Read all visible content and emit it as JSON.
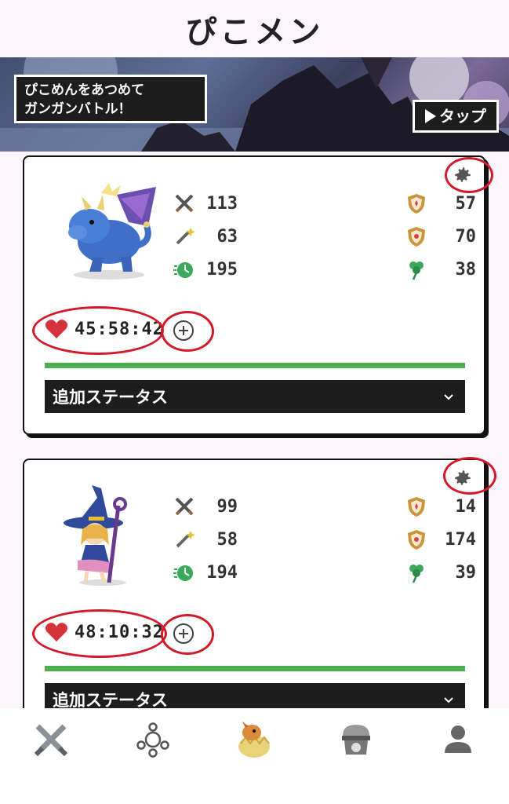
{
  "app": {
    "title": "ぴこメン"
  },
  "banner": {
    "line1": "ぴこめんをあつめて",
    "line2": "ガンガンバトル！",
    "tap_label": "タップ"
  },
  "cards": [
    {
      "character": "dragon",
      "stats_left": [
        {
          "icon": "sword-icon",
          "value": "113"
        },
        {
          "icon": "magic-wand-icon",
          "value": "63"
        },
        {
          "icon": "speed-icon",
          "value": "195"
        }
      ],
      "stats_right": [
        {
          "icon": "shield-icon",
          "value": "57"
        },
        {
          "icon": "magic-shield-icon",
          "value": "70"
        },
        {
          "icon": "clover-icon",
          "value": "38"
        }
      ],
      "hp_time": "45:58:42",
      "hp_fill": 1.0,
      "extra_label": "追加ステータス"
    },
    {
      "character": "witch",
      "stats_left": [
        {
          "icon": "sword-icon",
          "value": "99"
        },
        {
          "icon": "magic-wand-icon",
          "value": "58"
        },
        {
          "icon": "speed-icon",
          "value": "194"
        }
      ],
      "stats_right": [
        {
          "icon": "shield-icon",
          "value": "14"
        },
        {
          "icon": "magic-shield-icon",
          "value": "174"
        },
        {
          "icon": "clover-icon",
          "value": "39"
        }
      ],
      "hp_time": "48:10:32",
      "hp_fill": 1.0,
      "extra_label": "追加ステータス"
    }
  ],
  "nav": [
    "battle-nav-icon",
    "party-nav-icon",
    "monster-nav-icon",
    "gacha-nav-icon",
    "profile-nav-icon"
  ],
  "colors": {
    "accent_green": "#4caf50",
    "highlight_red": "#d21a2a",
    "dark_bar": "#1d1d1d",
    "background": "#fcf5fc"
  }
}
